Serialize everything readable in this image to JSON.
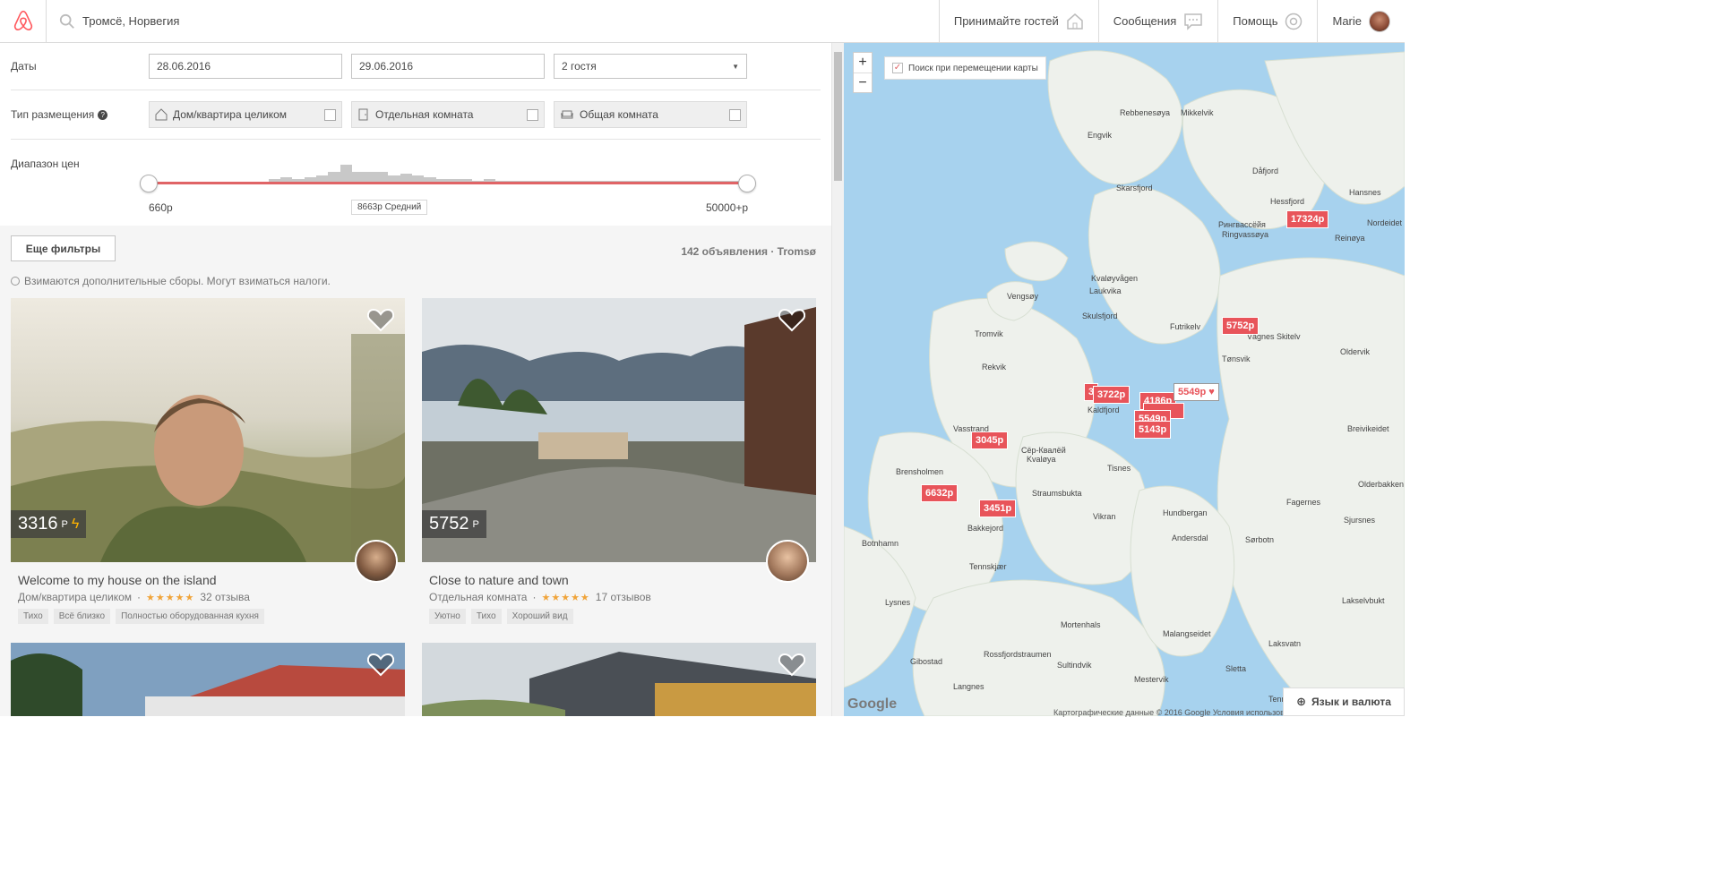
{
  "header": {
    "search_value": "Тромсё, Норвегия",
    "nav": [
      "Принимайте гостей",
      "Сообщения",
      "Помощь"
    ],
    "user": "Marie",
    "icons": [
      "airbnb-logo",
      "search-icon",
      "house-icon",
      "chat-icon",
      "help-icon"
    ]
  },
  "filters": {
    "dates_label": "Даты",
    "checkin": "28.06.2016",
    "checkout": "29.06.2016",
    "guests": "2 гостя",
    "room_type_label": "Тип размещения",
    "room_types": [
      "Дом/квартира целиком",
      "Отдельная комната",
      "Общая комната"
    ],
    "price_label": "Диапазон цен",
    "price_min": "660р",
    "price_max": "50000+р",
    "price_avg": "8663р Средний",
    "histogram": [
      0,
      0,
      0,
      0,
      0,
      0,
      0,
      0,
      0,
      0,
      2,
      3,
      2,
      3,
      4,
      6,
      10,
      6,
      6,
      6,
      4,
      5,
      4,
      3,
      2,
      2,
      2,
      1,
      2,
      1,
      1,
      1,
      1,
      1,
      1,
      1,
      1,
      1,
      1,
      1,
      1,
      1,
      1,
      1,
      1,
      1,
      1,
      1,
      1,
      1
    ]
  },
  "results": {
    "more_filters": "Еще фильтры",
    "count": "142 объявления · Tromsø",
    "fees_note": "Взимаются дополнительные сборы. Могут взиматься налоги.",
    "listings": [
      {
        "price": "3316",
        "currency": "Р",
        "title": "Welcome to my house on the island",
        "type": "Дом/квартира целиком",
        "reviews": "32 отзыва",
        "tags": [
          "Тихо",
          "Всё близко",
          "Полностью оборудованная кухня"
        ],
        "instant": true
      },
      {
        "price": "5752",
        "currency": "Р",
        "title": "Close to nature and town",
        "type": "Отдельная комната",
        "reviews": "17 отзывов",
        "tags": [
          "Уютно",
          "Тихо",
          "Хороший вид"
        ],
        "instant": false
      }
    ]
  },
  "map": {
    "search_on_move": "Поиск при перемещении карты",
    "pins": [
      "17324р",
      "5752р",
      "3722р",
      "3",
      "4186р",
      "5549р",
      "5143р",
      "5549р",
      "3045р",
      "6632р",
      "3451р"
    ],
    "places": [
      "Rebbenesøya",
      "Mikkelvik",
      "Engvik",
      "Dåfjord",
      "Hessfjord",
      "Hansnes",
      "Skarsfjord",
      "Рингвассёйя",
      "Ringvassøya",
      "Reinøya",
      "Nordeidet",
      "Kvaløyvågen",
      "Vengsøy",
      "Laukvika",
      "Skulsfjord",
      "Futrikelv",
      "Vågnes Skitelv",
      "Oldervik",
      "Tromvik",
      "Tønsvik",
      "Rekvik",
      "Kaldfjord",
      "Vasstrand",
      "Сёр-Квалёй",
      "Kvaløya",
      "Tisnes",
      "Breivikeidet",
      "Brensholmen",
      "Straumsbukta",
      "Fagernes",
      "Olderbakken",
      "Hundbergan",
      "Sjursnes",
      "Bakkejord",
      "Vikran",
      "Andersdal",
      "Sørbotn",
      "Botnhamn",
      "Tennskjær",
      "Lysnes",
      "Mortenhals",
      "Malangseidet",
      "Laksvatn",
      "Lakselvbukt",
      "Gibostad",
      "Rossfjordstraumen",
      "Sultindvik",
      "Sletta",
      "Langnes",
      "Mestervik",
      "Tennes",
      "Hessfjord"
    ],
    "attribution": "Картографические данные © 2016 Google   Условия использов",
    "lang_button": "Язык и валюта",
    "google": "Google"
  }
}
